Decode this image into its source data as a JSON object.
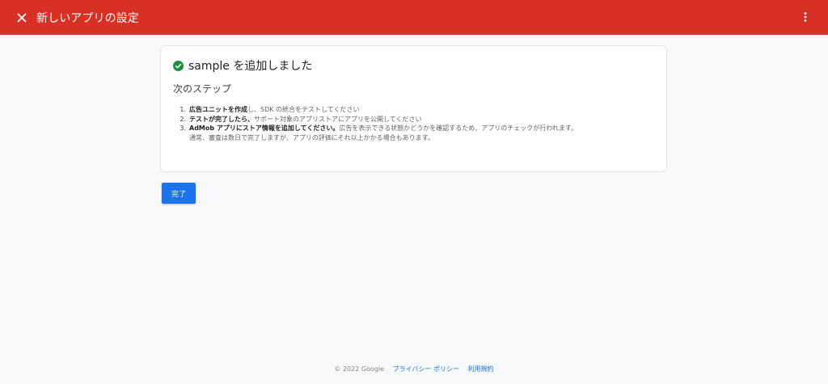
{
  "header": {
    "title": "新しいアプリの設定",
    "close_icon": "close-icon",
    "more_icon": "more-vert-icon",
    "background_color": "#d93025"
  },
  "card": {
    "heading_icon": "check-circle-icon",
    "heading_icon_color": "#1e8e3e",
    "heading": "sample を追加しました",
    "section_title": "次のステップ",
    "steps": [
      {
        "number": "1.",
        "bold": "広告ユニットを作成",
        "text": "し、SDK の統合をテストしてください"
      },
      {
        "number": "2.",
        "bold": "テストが完了したら、",
        "text": "サポート対象のアプリストアにアプリを公開してください"
      },
      {
        "number": "3.",
        "bold": "AdMob アプリにストア情報を追加してください。",
        "text": "広告を表示できる状態かどうかを確認するため、アプリのチェックが行われます。",
        "text2": "通常、審査は数日で完了しますが、アプリの評価にそれ以上かかる場合もあります。"
      }
    ]
  },
  "actions": {
    "done_label": "完了",
    "accent_color": "#1a73e8"
  },
  "footer": {
    "copyright": "© 2022 Google",
    "privacy_link": "プライバシー ポリシー",
    "terms_link": "利用規約"
  }
}
